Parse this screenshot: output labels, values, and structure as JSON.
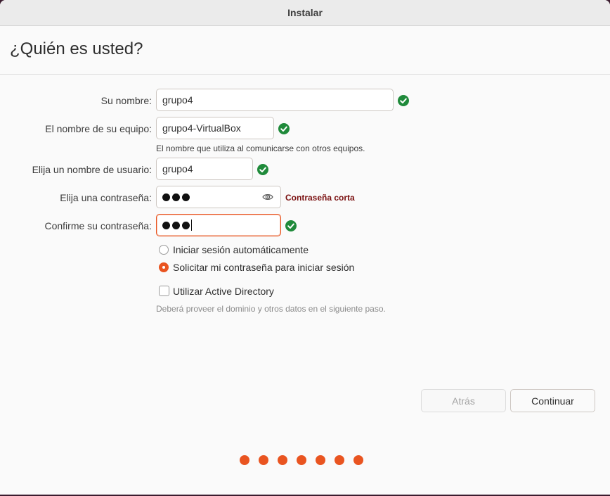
{
  "window": {
    "title": "Instalar"
  },
  "page": {
    "title": "¿Quién es usted?"
  },
  "form": {
    "name": {
      "label": "Su nombre:",
      "value": "grupo4"
    },
    "computer": {
      "label": "El nombre de su equipo:",
      "value": "grupo4-VirtualBox",
      "hint": "El nombre que utiliza al comunicarse con otros equipos."
    },
    "username": {
      "label": "Elija un nombre de usuario:",
      "value": "grupo4"
    },
    "password": {
      "label": "Elija una contraseña:",
      "masked_length": 3,
      "warning": "Contraseña corta"
    },
    "confirm": {
      "label": "Confirme su contraseña:",
      "masked_length": 3
    }
  },
  "login_options": [
    {
      "label": "Iniciar sesión automáticamente",
      "selected": false
    },
    {
      "label": "Solicitar mi contraseña para iniciar sesión",
      "selected": true
    }
  ],
  "active_directory": {
    "label": "Utilizar Active Directory",
    "checked": false,
    "hint": "Deberá proveer el dominio y otros datos en el siguiente paso."
  },
  "buttons": {
    "back": "Atrás",
    "continue": "Continuar"
  },
  "progress": {
    "total_steps": 7
  },
  "colors": {
    "accent": "#e95420",
    "valid": "#1f8a3a",
    "warning": "#7a1010"
  },
  "icons": {
    "valid": "check-circle-icon",
    "reveal": "eye-icon"
  }
}
